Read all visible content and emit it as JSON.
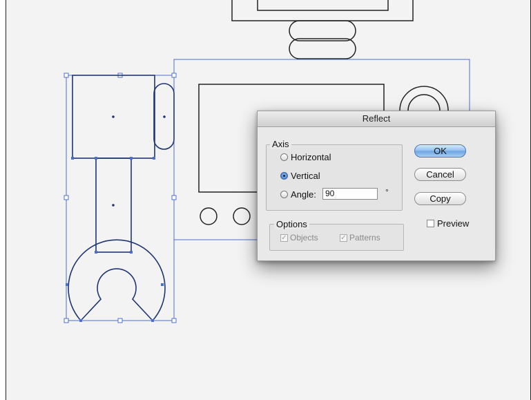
{
  "dialog": {
    "title": "Reflect",
    "axis_group_label": "Axis",
    "axis_options": [
      {
        "label": "Horizontal",
        "selected": false
      },
      {
        "label": "Vertical",
        "selected": true
      },
      {
        "label": "Angle:",
        "selected": false
      }
    ],
    "angle_value": "90",
    "degree_symbol": "°",
    "options_group_label": "Options",
    "options": [
      {
        "label": "Objects",
        "checked": true,
        "disabled": true
      },
      {
        "label": "Patterns",
        "checked": true,
        "disabled": true
      }
    ],
    "buttons": {
      "ok": "OK",
      "cancel": "Cancel",
      "copy": "Copy"
    },
    "preview_label": "Preview",
    "preview_checked": false
  },
  "colors": {
    "canvas_bg": "#f3f3f3",
    "artwork_stroke": "#222222",
    "selection_blue": "#4a6fd0",
    "dialog_bg": "#e9e9e9",
    "default_button": "#6aa3e2"
  }
}
